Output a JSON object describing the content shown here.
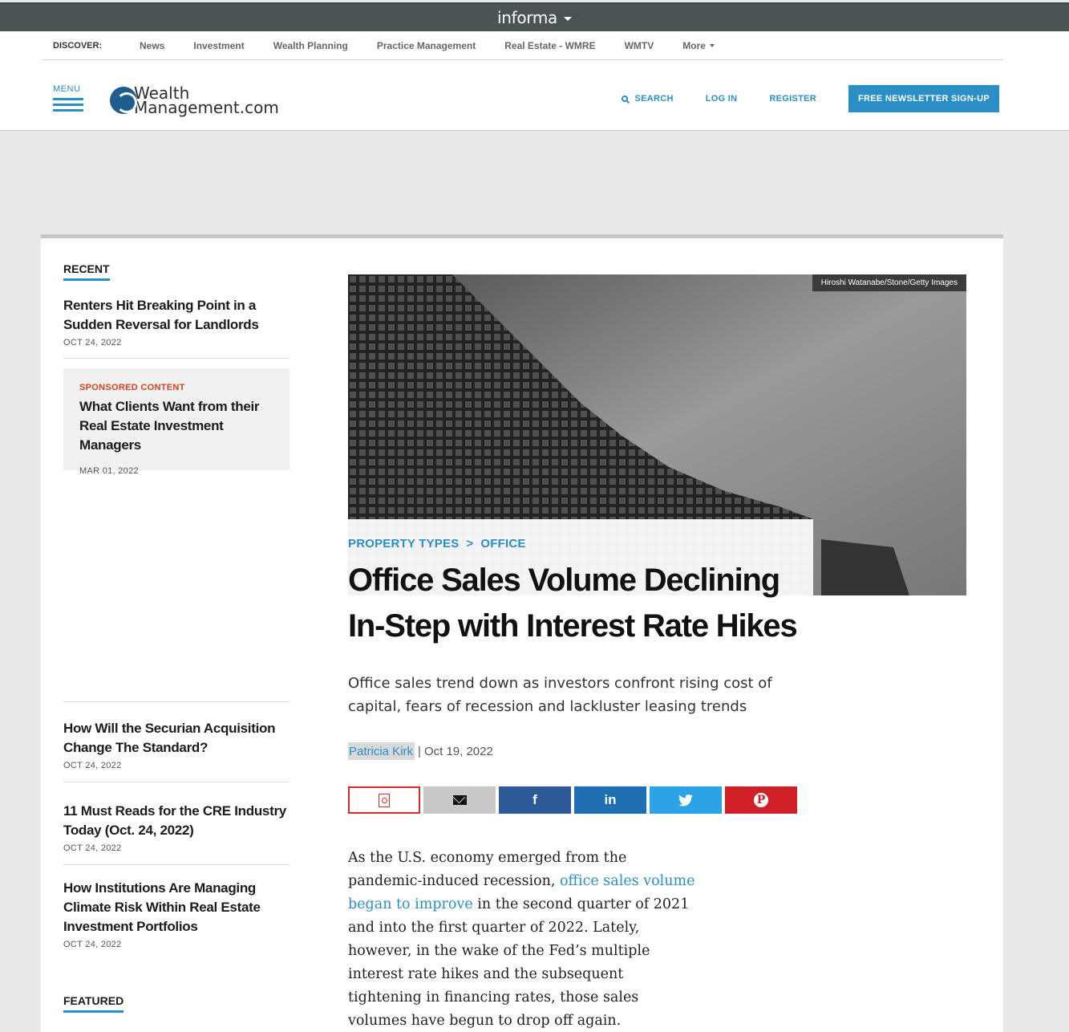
{
  "informa": {
    "logo": "informa"
  },
  "discover": {
    "label": "DISCOVER:",
    "items": [
      "News",
      "Investment",
      "Wealth Planning",
      "Practice Management",
      "Real Estate - WMRE",
      "WMTV",
      "More"
    ]
  },
  "header": {
    "menu_label": "MENU",
    "logo_line1": "Wealth",
    "logo_line2": "Management.com",
    "search": "SEARCH",
    "login": "LOG IN",
    "register": "REGISTER",
    "newsletter": "FREE NEWSLETTER SIGN-UP"
  },
  "sidebar": {
    "recent_title": "RECENT",
    "stories": [
      {
        "title": "Renters Hit Breaking Point in a Sudden Reversal for Landlords",
        "date": "OCT 24, 2022"
      },
      {
        "title": "How Will the Securian Acquisition Change The Standard?",
        "date": "OCT 24, 2022"
      },
      {
        "title": "11 Must Reads for the CRE Industry Today (Oct. 24, 2022)",
        "date": "OCT 24, 2022"
      },
      {
        "title": "How Institutions Are Managing Climate Risk Within Real Estate Investment Portfolios",
        "date": "OCT 24, 2022"
      }
    ],
    "sponsored": {
      "tag": "SPONSORED CONTENT",
      "title": "What Clients Want from their Real Estate Investment Managers",
      "date": "MAR 01, 2022"
    },
    "featured_title": "FEATURED"
  },
  "article": {
    "image_credit": "Hiroshi Watanabe/Stone/Getty Images",
    "breadcrumb": [
      "PROPERTY TYPES",
      ">",
      "OFFICE"
    ],
    "headline": "Office Sales Volume Declining In-Step with Interest Rate Hikes",
    "subhead": "Office sales trend down as investors confront rising cost of capital, fears of recession and lackluster leasing trends",
    "author": "Patricia Kirk",
    "separator": "|",
    "date": "Oct 19, 2022",
    "share": {
      "facebook": "f",
      "linkedin": "in",
      "twitter": "🐦",
      "pinterest": "P"
    },
    "body_before": "As the U.S. economy emerged from the pandemic-induced recession, ",
    "body_link": "office sales volume began to improve",
    "body_after": " in the second quarter of 2021 and into the first quarter of 2022. Lately, however, in the wake of the Fed’s multiple interest rate hikes and the subsequent tightening in financing rates, those sales volumes have begun to drop off again."
  },
  "colors": {
    "accent": "#2a8ec7",
    "sponsored": "#d6421e",
    "informa_bar": "#4a5457"
  }
}
